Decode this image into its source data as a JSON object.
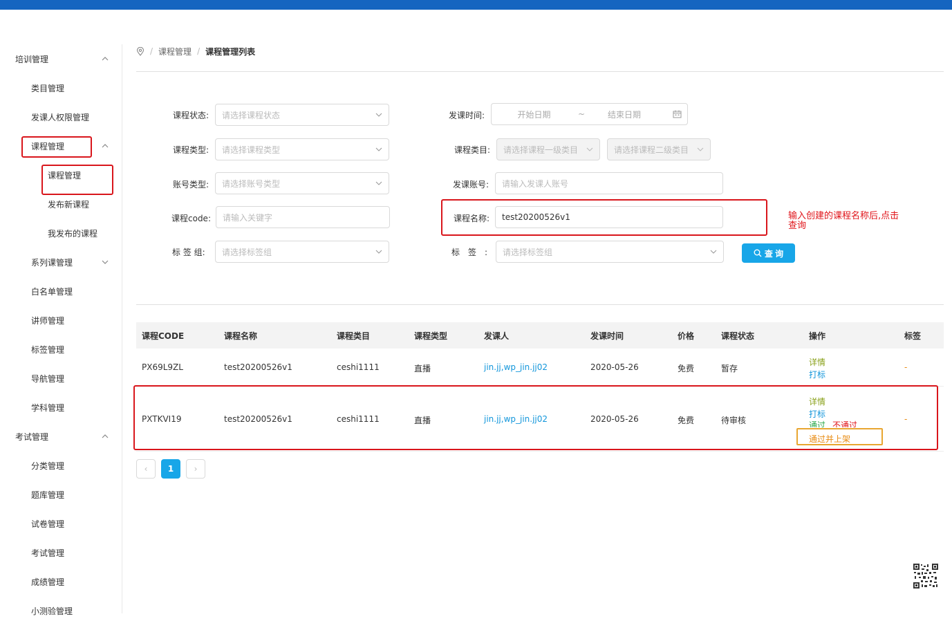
{
  "sidebar": {
    "items": [
      {
        "label": "培训管理",
        "chevron": "up"
      },
      {
        "label": "类目管理"
      },
      {
        "label": "发课人权限管理"
      },
      {
        "label": "课程管理",
        "chevron": "up"
      },
      {
        "label": "课程管理"
      },
      {
        "label": "发布新课程"
      },
      {
        "label": "我发布的课程"
      },
      {
        "label": "系列课管理",
        "chevron": "down"
      },
      {
        "label": "白名单管理"
      },
      {
        "label": "讲师管理"
      },
      {
        "label": "标签管理"
      },
      {
        "label": "导航管理"
      },
      {
        "label": "学科管理"
      },
      {
        "label": "考试管理",
        "chevron": "up"
      },
      {
        "label": "分类管理"
      },
      {
        "label": "题库管理"
      },
      {
        "label": "试卷管理"
      },
      {
        "label": "考试管理"
      },
      {
        "label": "成绩管理"
      },
      {
        "label": "小测验管理"
      }
    ]
  },
  "breadcrumb": {
    "root": "课程管理",
    "separator": "/",
    "current": "课程管理列表"
  },
  "form": {
    "course_status": {
      "label": "课程状态:",
      "placeholder": "请选择课程状态"
    },
    "publish_time": {
      "label": "发课时间:",
      "start": "开始日期",
      "tilde": "~",
      "end": "结束日期"
    },
    "course_type": {
      "label": "课程类型:",
      "placeholder": "请选择课程类型"
    },
    "course_category": {
      "label": "课程类目:",
      "placeholder1": "请选择课程一级类目",
      "placeholder2": "请选择课程二级类目"
    },
    "account_type": {
      "label": "账号类型:",
      "placeholder": "请选择账号类型"
    },
    "publisher_account": {
      "label": "发课账号:",
      "placeholder": "请输入发课人账号"
    },
    "course_code": {
      "label": "课程code:",
      "placeholder": "请输入关键字"
    },
    "course_name": {
      "label": "课程名称:",
      "value": "test20200526v1"
    },
    "tag_group": {
      "label": "标 签 组:",
      "placeholder": "请选择标签组"
    },
    "tag": {
      "label": "标　签　:",
      "placeholder": "请选择标签组"
    },
    "search_label": "查 询"
  },
  "annotation": "输入创建的课程名称后,点击查询",
  "table": {
    "headers": [
      "课程CODE",
      "课程名称",
      "课程类目",
      "课程类型",
      "发课人",
      "发课时间",
      "价格",
      "课程状态",
      "操作",
      "标签"
    ],
    "rows": [
      {
        "code": "PX69L9ZL",
        "name": "test20200526v1",
        "category": "ceshi1111",
        "type": "直播",
        "publisher": "jin.jj,wp_jin.jj02",
        "time": "2020-05-26",
        "price": "免费",
        "status": "暂存",
        "op_detail": "详情",
        "op_mark": "打标",
        "tag": "-"
      },
      {
        "code": "PXTKVI19",
        "name": "test20200526v1",
        "category": "ceshi1111",
        "type": "直播",
        "publisher": "jin.jj,wp_jin.jj02",
        "time": "2020-05-26",
        "price": "免费",
        "status": "待审核",
        "op_detail": "详情",
        "op_mark": "打标",
        "op_pass": "通过",
        "op_fail": "不通过",
        "op_pass_shelf": "通过并上架",
        "tag": "-"
      }
    ]
  },
  "pagination": {
    "prev": "‹",
    "page": "1",
    "next": "›"
  },
  "colors": {
    "primary": "#18a6e8",
    "topbar": "#1565c0",
    "highlight": "#d9151b",
    "accent_box": "#e8a630"
  }
}
